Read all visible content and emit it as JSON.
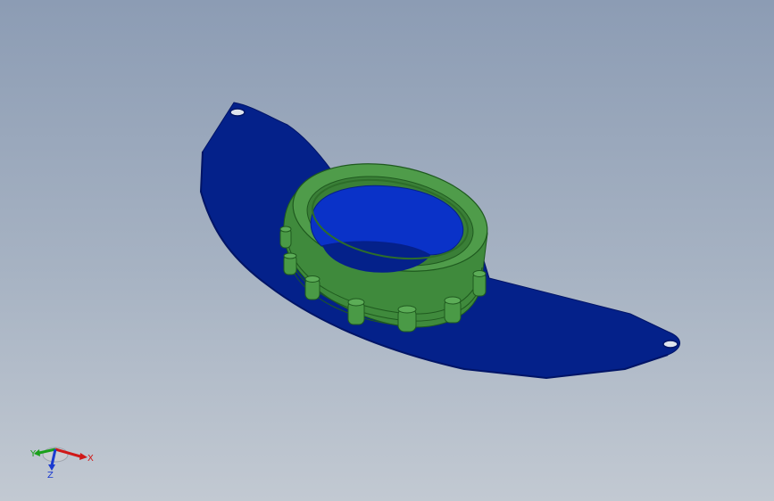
{
  "viewport": {
    "background_top": "#8c9cb4",
    "background_bottom": "#c2c9d2"
  },
  "model": {
    "bracket": {
      "color": "#04218a",
      "edge_color": "#001466"
    },
    "ring": {
      "color": "#3f8a3c",
      "edge_color": "#1f5a1f"
    },
    "ring_interior": {
      "color": "#0a32c8"
    }
  },
  "triad": {
    "x_label": "X",
    "y_label": "Y",
    "z_label": "Z",
    "x_color": "#d01818",
    "y_color": "#1aa01a",
    "z_color": "#1a3ad0"
  }
}
